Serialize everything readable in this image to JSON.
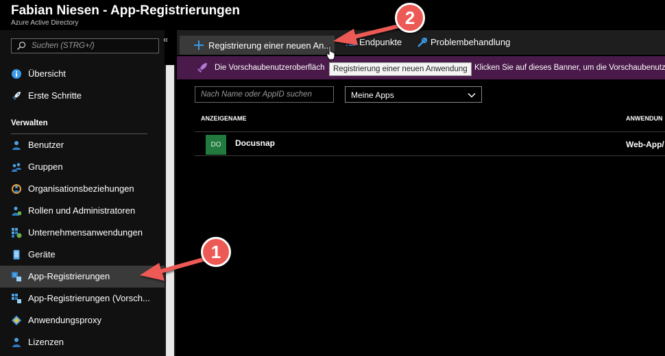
{
  "header": {
    "title": "Fabian Niesen - App-Registrierungen",
    "subtitle": "Azure Active Directory"
  },
  "sidebar": {
    "collapse_glyph": "«",
    "search_placeholder": "Suchen (STRG+/)",
    "section_label": "Verwalten",
    "items": [
      {
        "label": "Übersicht",
        "icon": "info-icon"
      },
      {
        "label": "Erste Schritte",
        "icon": "rocket-icon"
      },
      {
        "label": "Benutzer",
        "icon": "user-icon"
      },
      {
        "label": "Gruppen",
        "icon": "group-icon"
      },
      {
        "label": "Organisationsbeziehungen",
        "icon": "org-relations-icon"
      },
      {
        "label": "Rollen und Administratoren",
        "icon": "roles-icon"
      },
      {
        "label": "Unternehmensanwendungen",
        "icon": "enterprise-apps-icon"
      },
      {
        "label": "Geräte",
        "icon": "device-icon"
      },
      {
        "label": "App-Registrierungen",
        "icon": "app-registrations-icon",
        "active": true
      },
      {
        "label": "App-Registrierungen (Vorsch...",
        "icon": "app-registrations-preview-icon"
      },
      {
        "label": "Anwendungsproxy",
        "icon": "app-proxy-icon"
      },
      {
        "label": "Lizenzen",
        "icon": "licenses-icon"
      }
    ]
  },
  "toolbar": {
    "new_registration": "Registrierung einer neuen An...",
    "endpoints": "Endpunkte",
    "troubleshoot": "Problembehandlung"
  },
  "banner": {
    "text": "Die Vorschaubenutzeroberfläch",
    "text_tail": "Klicken Sie auf dieses Banner, um die Vorschaubenutz"
  },
  "tooltip": "Registrierung einer neuen Anwendung",
  "filter": {
    "search_placeholder": "Nach Name oder AppID suchen",
    "dropdown_value": "Meine Apps"
  },
  "table": {
    "headers": [
      "ANZEIGENAME",
      "ANWENDUN"
    ],
    "rows": [
      {
        "avatar": "DO",
        "name": "Docusnap",
        "type": "Web-App/"
      }
    ]
  },
  "annotations": {
    "badge1": "1",
    "badge2": "2"
  },
  "colors": {
    "accent": "#0078d4",
    "banner": "#4a1a4a",
    "annotation_red": "#ed5a55",
    "avatar_green": "#237a3f"
  }
}
